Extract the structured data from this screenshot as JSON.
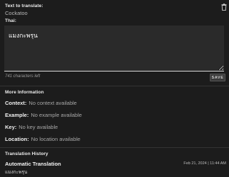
{
  "source": {
    "label": "Text to translate:",
    "text": "Cockatoo"
  },
  "target": {
    "label": "Thai:",
    "value": "แมงกะพรุน",
    "char_count": "741 characters left",
    "save_label": "SAVE"
  },
  "more_info": {
    "heading": "More Information",
    "rows": [
      {
        "key": "Context:",
        "value": "No context available"
      },
      {
        "key": "Example:",
        "value": "No example available"
      },
      {
        "key": "Key:",
        "value": "No key available"
      },
      {
        "key": "Location:",
        "value": "No location available"
      }
    ]
  },
  "history": {
    "heading": "Translation History",
    "entries": [
      {
        "title": "Automatic Translation",
        "date": "Feb 21, 2024 | 11:44 AM",
        "text": "แมงกะพรุน"
      }
    ]
  },
  "icons": {
    "delete": "trash-icon"
  }
}
